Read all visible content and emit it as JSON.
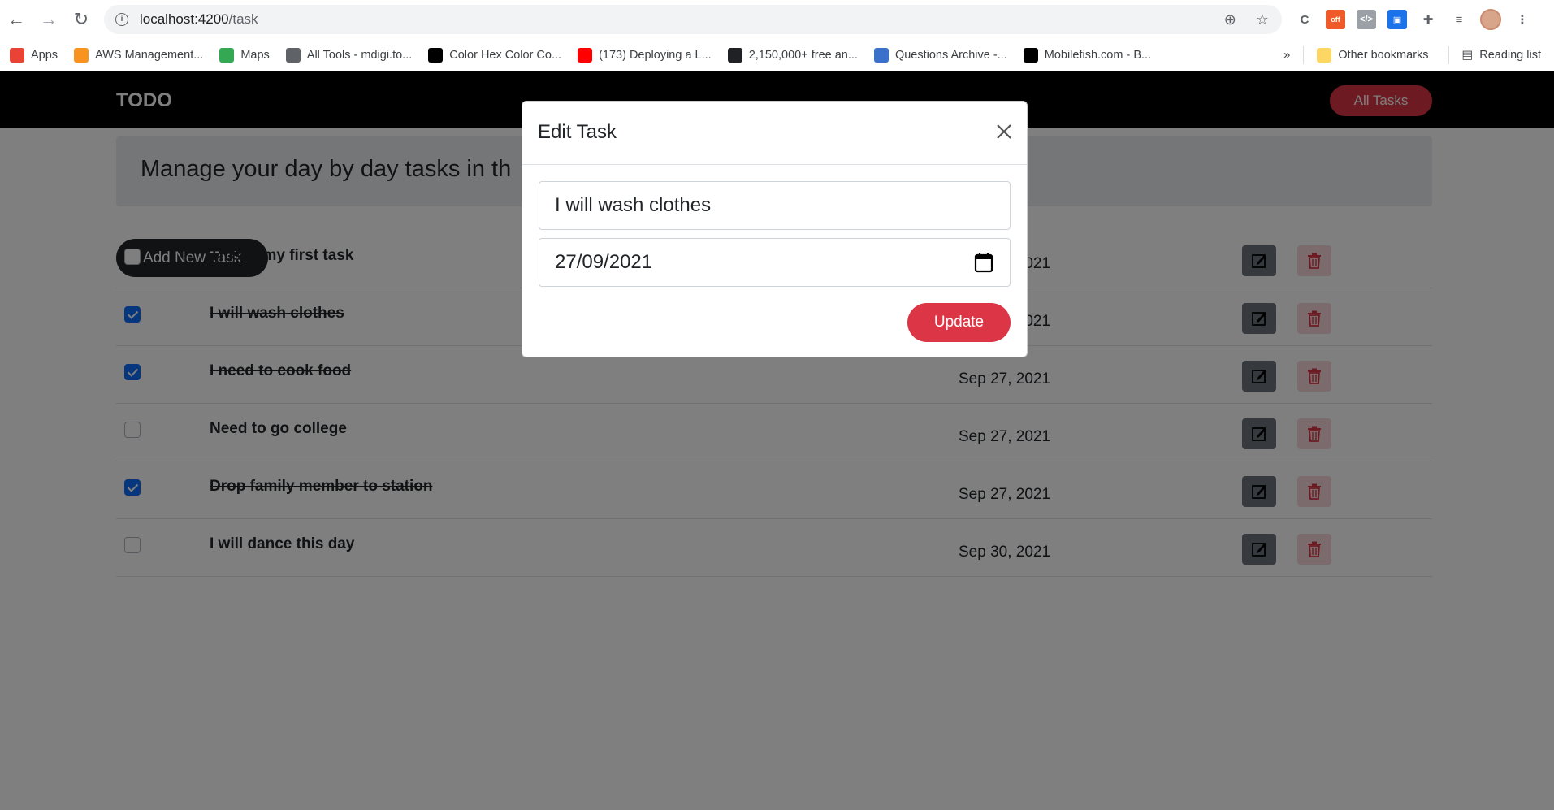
{
  "browser": {
    "url_host": "localhost:4200",
    "url_path": "/task",
    "bookmarks": [
      {
        "label": "Apps",
        "icon": "apps-grid-icon",
        "color": "#ea4335"
      },
      {
        "label": "AWS Management...",
        "icon": "aws-icon",
        "color": "#f7931e"
      },
      {
        "label": "Maps",
        "icon": "maps-pin-icon",
        "color": "#34a853"
      },
      {
        "label": "All Tools - mdigi.to...",
        "icon": "tools-icon",
        "color": "#5f6368"
      },
      {
        "label": "Color Hex Color Co...",
        "icon": "colorhex-icon",
        "color": "#000000"
      },
      {
        "label": "(173) Deploying a L...",
        "icon": "youtube-icon",
        "color": "#ff0000"
      },
      {
        "label": "2,150,000+ free an...",
        "icon": "freepik-icon",
        "color": "#202124"
      },
      {
        "label": "Questions Archive -...",
        "icon": "mdb-icon",
        "color": "#3b71ca"
      },
      {
        "label": "Mobilefish.com - B...",
        "icon": "mobilefish-icon",
        "color": "#000000"
      }
    ],
    "more_bookmarks": "»",
    "other_bookmarks": "Other bookmarks",
    "reading_list": "Reading list"
  },
  "app": {
    "brand": "TODO",
    "all_tasks_label": "All Tasks",
    "jumbotron_text": "Manage your day by day tasks in th",
    "add_task_label": "Add New Task",
    "tasks": [
      {
        "title": "This is my first task",
        "date": "Sep 27, 2021",
        "completed": false
      },
      {
        "title": "I will wash clothes",
        "date": "Sep 27, 2021",
        "completed": true
      },
      {
        "title": "I need to cook food",
        "date": "Sep 27, 2021",
        "completed": true
      },
      {
        "title": "Need to go college",
        "date": "Sep 27, 2021",
        "completed": false
      },
      {
        "title": "Drop family member to station",
        "date": "Sep 27, 2021",
        "completed": true
      },
      {
        "title": "I will dance this day",
        "date": "Sep 30, 2021",
        "completed": false
      }
    ]
  },
  "modal": {
    "title": "Edit Task",
    "task_value": "I will wash clothes",
    "date_value": "27/09/2021",
    "update_label": "Update"
  },
  "colors": {
    "accent_red": "#dc3545",
    "checkbox_blue": "#0d6efd",
    "navbar": "#000000"
  }
}
